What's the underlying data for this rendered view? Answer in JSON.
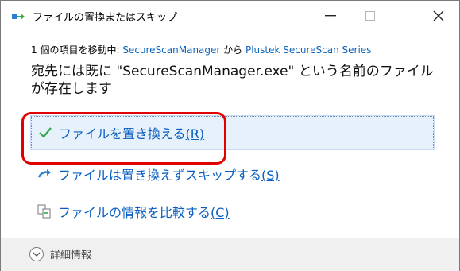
{
  "window": {
    "title": "ファイルの置換またはスキップ",
    "minimize": "—",
    "maximize": "□",
    "close": "✕"
  },
  "move": {
    "prefix": "1 個の項目を移動中: ",
    "source": "SecureScanManager",
    "middle": " から ",
    "destination": "Plustek SecureScan Series"
  },
  "message": "宛先には既に \"SecureScanManager.exe\" という名前のファイルが存在します",
  "options": [
    {
      "label": "ファイルを置き換える",
      "key": "(R)",
      "icon": "checkmark-icon"
    },
    {
      "label": "ファイルは置き換えずスキップする",
      "key": "(S)",
      "icon": "skip-arrow-icon"
    },
    {
      "label": "ファイルの情報を比較する",
      "key": "(C)",
      "icon": "compare-files-icon"
    }
  ],
  "footer": {
    "details_label": "詳細情報"
  },
  "colors": {
    "link": "#0b63b8",
    "option_text": "#0b5fc0",
    "highlight": "#e10000",
    "selected_bg": "#e7f1fb"
  }
}
